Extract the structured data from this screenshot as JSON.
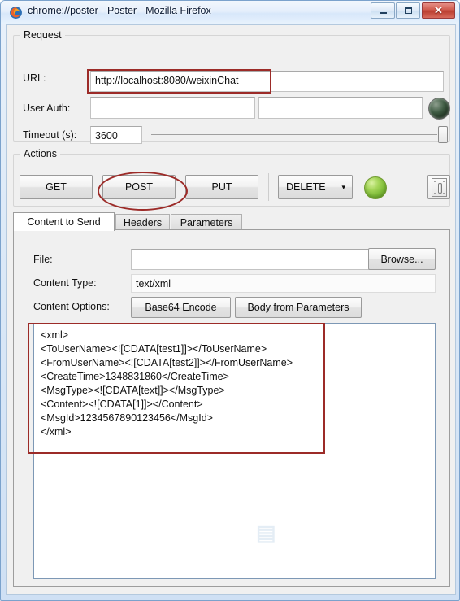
{
  "window": {
    "title": "chrome://poster - Poster - Mozilla Firefox",
    "app_icon": "firefox-logo-icon",
    "controls": {
      "minimize": "minimize-icon",
      "maximize": "maximize-icon",
      "close": "✕"
    }
  },
  "request": {
    "group_title": "Request",
    "url_label": "URL:",
    "url_value": "http://localhost:8080/weixinChat",
    "url_placeholder": "",
    "auth_label": "User Auth:",
    "auth_user_value": "",
    "auth_user_placeholder": "",
    "auth_pass_value": "",
    "auth_pass_placeholder": "",
    "auth_indicator": "auth-status-orb-icon",
    "timeout_label": "Timeout (s):",
    "timeout_value": "3600"
  },
  "actions": {
    "group_title": "Actions",
    "get_label": "GET",
    "post_label": "POST",
    "put_label": "PUT",
    "delete_label": "DELETE",
    "delete_caret": "▾",
    "send_indicator": "send-status-orb-icon",
    "switch_icon": "light-switch-icon"
  },
  "tabs": [
    {
      "label": "Content to Send",
      "active": true
    },
    {
      "label": "Headers",
      "active": false
    },
    {
      "label": "Parameters",
      "active": false
    }
  ],
  "content_panel": {
    "file_label": "File:",
    "file_value": "",
    "file_placeholder": "",
    "browse_label": "Browse...",
    "content_type_label": "Content Type:",
    "content_type_value": "text/xml",
    "content_options_label": "Content Options:",
    "base64_label": "Base64 Encode",
    "body_from_params_label": "Body from Parameters",
    "body_value": "<xml>\n<ToUserName><![CDATA[test1]]></ToUserName>\n<FromUserName><![CDATA[test2]]></FromUserName>\n<CreateTime>1348831860</CreateTime>\n<MsgType><![CDATA[text]]></MsgType>\n<Content><![CDATA[1]]></Content>\n<MsgId>1234567890123456</MsgId>\n</xml>"
  },
  "annotations": {
    "color": "#9c2b28",
    "url_highlight": "rectangle around URL value",
    "post_highlight": "ellipse around POST button",
    "body_highlight": "rectangle around XML body text"
  }
}
